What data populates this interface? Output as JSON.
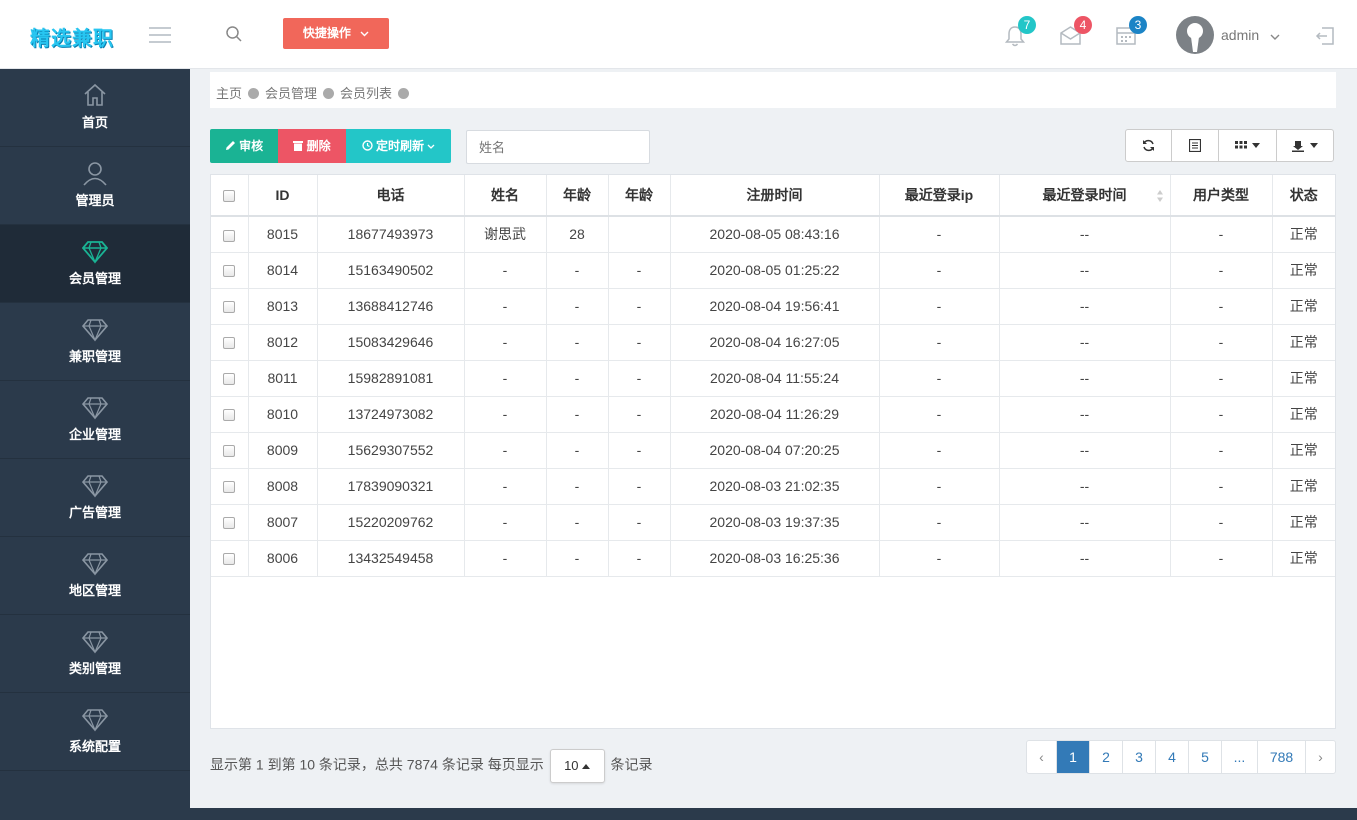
{
  "app": {
    "logo": "精选兼职"
  },
  "topbar": {
    "quick_action": "快捷操作",
    "notifications": {
      "bell": "7",
      "mail": "4",
      "calendar": "3"
    },
    "badge_colors": {
      "bell": "#23c6c8",
      "mail": "#ed5565",
      "calendar": "#1c84c6"
    },
    "user_name": "admin"
  },
  "sidebar": {
    "items": [
      {
        "label": "首页",
        "icon": "home-icon"
      },
      {
        "label": "管理员",
        "icon": "user-icon"
      },
      {
        "label": "会员管理",
        "icon": "diamond-icon"
      },
      {
        "label": "兼职管理",
        "icon": "diamond-icon"
      },
      {
        "label": "企业管理",
        "icon": "diamond-icon"
      },
      {
        "label": "广告管理",
        "icon": "diamond-icon"
      },
      {
        "label": "地区管理",
        "icon": "diamond-icon"
      },
      {
        "label": "类别管理",
        "icon": "diamond-icon"
      },
      {
        "label": "系统配置",
        "icon": "diamond-icon"
      }
    ],
    "active_index": 2
  },
  "breadcrumb": [
    "主页",
    "会员管理",
    "会员列表"
  ],
  "toolbar": {
    "audit_label": "审核",
    "delete_label": "删除",
    "refresh_label": "定时刷新",
    "search_placeholder": "姓名",
    "colors": {
      "audit": "#1ab394",
      "delete": "#ed5565",
      "refresh": "#23c6c8"
    }
  },
  "table": {
    "columns": [
      "ID",
      "电话",
      "姓名",
      "年龄",
      "年龄",
      "注册时间",
      "最近登录ip",
      "最近登录时间",
      "用户类型",
      "状态"
    ],
    "rows": [
      [
        "8015",
        "18677493973",
        "谢思武",
        "28",
        "",
        "2020-08-05 08:43:16",
        "-",
        "--",
        "-",
        "正常"
      ],
      [
        "8014",
        "15163490502",
        "-",
        "-",
        "-",
        "2020-08-05 01:25:22",
        "-",
        "--",
        "-",
        "正常"
      ],
      [
        "8013",
        "13688412746",
        "-",
        "-",
        "-",
        "2020-08-04 19:56:41",
        "-",
        "--",
        "-",
        "正常"
      ],
      [
        "8012",
        "15083429646",
        "-",
        "-",
        "-",
        "2020-08-04 16:27:05",
        "-",
        "--",
        "-",
        "正常"
      ],
      [
        "8011",
        "15982891081",
        "-",
        "-",
        "-",
        "2020-08-04 11:55:24",
        "-",
        "--",
        "-",
        "正常"
      ],
      [
        "8010",
        "13724973082",
        "-",
        "-",
        "-",
        "2020-08-04 11:26:29",
        "-",
        "--",
        "-",
        "正常"
      ],
      [
        "8009",
        "15629307552",
        "-",
        "-",
        "-",
        "2020-08-04 07:20:25",
        "-",
        "--",
        "-",
        "正常"
      ],
      [
        "8008",
        "17839090321",
        "-",
        "-",
        "-",
        "2020-08-03 21:02:35",
        "-",
        "--",
        "-",
        "正常"
      ],
      [
        "8007",
        "15220209762",
        "-",
        "-",
        "-",
        "2020-08-03 19:37:35",
        "-",
        "--",
        "-",
        "正常"
      ],
      [
        "8006",
        "13432549458",
        "-",
        "-",
        "-",
        "2020-08-03 16:25:36",
        "-",
        "--",
        "-",
        "正常"
      ]
    ]
  },
  "footer": {
    "info_prefix": "显示第 1 到第 10 条记录，总共 7874 条记录 每页显示",
    "page_size": "10",
    "info_suffix": "条记录"
  },
  "pagination": {
    "prev": "‹",
    "pages": [
      "1",
      "2",
      "3",
      "4",
      "5",
      "...",
      "788"
    ],
    "next": "›",
    "current": "1"
  }
}
